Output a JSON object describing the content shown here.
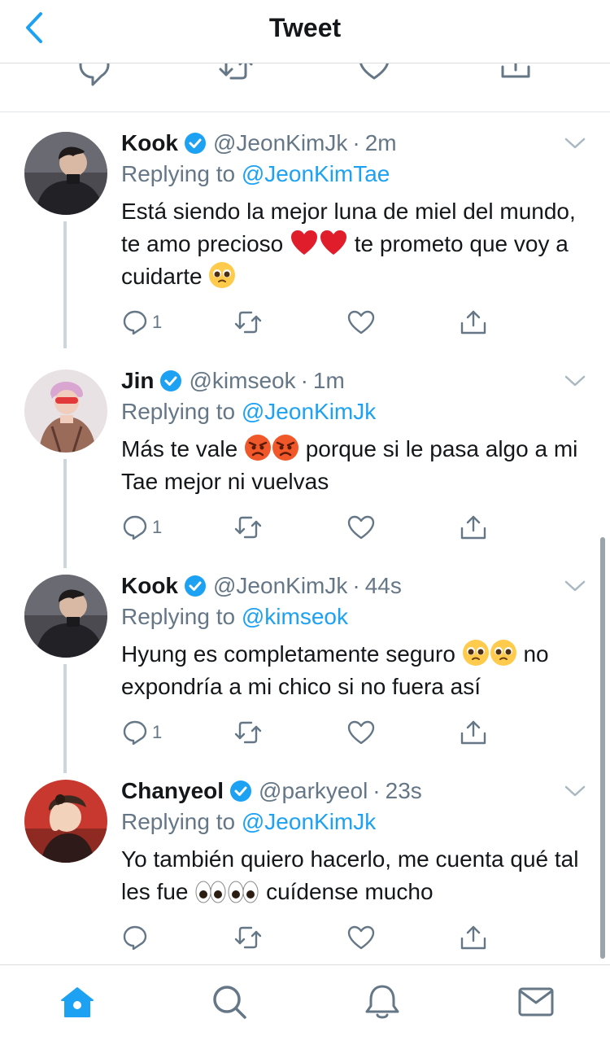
{
  "header": {
    "title": "Tweet",
    "back_icon": "chevron-left-icon",
    "accent": "#1da1f2"
  },
  "top_actions": [
    "reply-icon",
    "retweet-icon",
    "like-icon",
    "share-icon"
  ],
  "tweets": [
    {
      "name": "Kook",
      "handle": "@JeonKimJk",
      "dot": "·",
      "time": "2m",
      "replying_prefix": "Replying to",
      "replying_to": "@JeonKimTae",
      "text_1": "Está siendo la mejor luna de miel del mundo, te amo precioso",
      "text_2": "te prometo que voy a cuidarte",
      "emojis": [
        "red-heart",
        "red-heart",
        "pleading-face"
      ],
      "reply_count": "1"
    },
    {
      "name": "Jin",
      "handle": "@kimseok",
      "dot": "·",
      "time": "1m",
      "replying_prefix": "Replying to",
      "replying_to": "@JeonKimJk",
      "text_1": "Más te vale",
      "text_2": "porque si le pasa algo a mi Tae mejor ni vuelvas",
      "emojis": [
        "angry-face",
        "angry-face"
      ],
      "reply_count": "1"
    },
    {
      "name": "Kook",
      "handle": "@JeonKimJk",
      "dot": "·",
      "time": "44s",
      "replying_prefix": "Replying to",
      "replying_to": "@kimseok",
      "text_1": "Hyung es completamente seguro",
      "text_2": "no expondría a mi chico si no fuera así",
      "emojis": [
        "pleading-face",
        "pleading-face"
      ],
      "reply_count": "1"
    },
    {
      "name": "Chanyeol",
      "handle": "@parkyeol",
      "dot": "·",
      "time": "23s",
      "replying_prefix": "Replying to",
      "replying_to": "@JeonKimJk",
      "text_1": "Yo también quiero hacerlo, me cuenta qué tal les fue",
      "text_2": "cuídense mucho",
      "emojis": [
        "eyes",
        "eyes"
      ],
      "reply_count": ""
    }
  ],
  "tabbar": [
    "home-icon",
    "search-icon",
    "notifications-icon",
    "messages-icon"
  ]
}
